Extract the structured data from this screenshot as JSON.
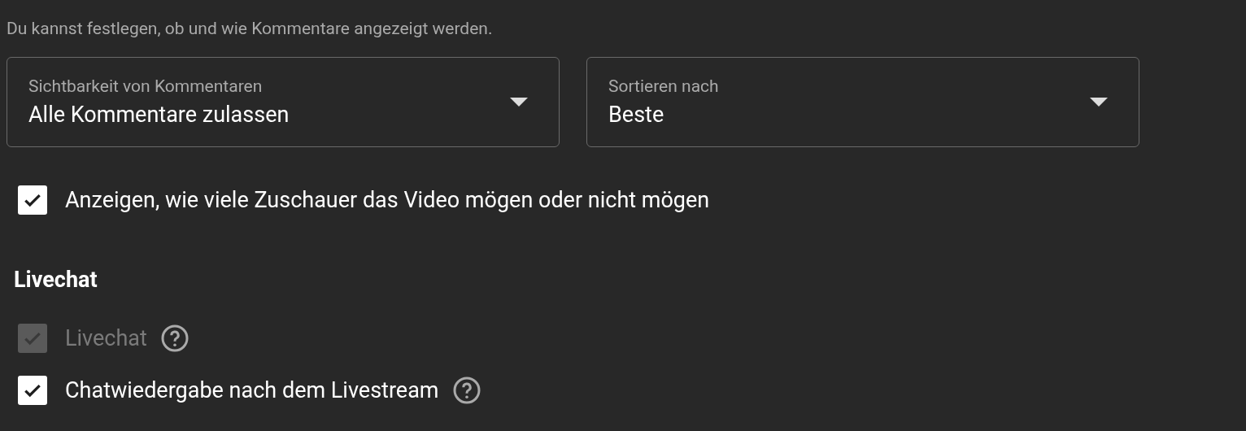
{
  "description": "Du kannst festlegen, ob und wie Kommentare angezeigt werden.",
  "dropdowns": [
    {
      "label": "Sichtbarkeit von Kommentaren",
      "value": "Alle Kommentare zulassen"
    },
    {
      "label": "Sortieren nach",
      "value": "Beste"
    }
  ],
  "options": [
    {
      "label": "Anzeigen, wie viele Zuschauer das Video mögen oder nicht mögen",
      "checked": true,
      "disabled": false,
      "help": false
    }
  ],
  "livechat": {
    "heading": "Livechat",
    "options": [
      {
        "label": "Livechat",
        "checked": true,
        "disabled": true,
        "help": true
      },
      {
        "label": "Chatwiedergabe nach dem Livestream",
        "checked": true,
        "disabled": false,
        "help": true
      }
    ]
  }
}
